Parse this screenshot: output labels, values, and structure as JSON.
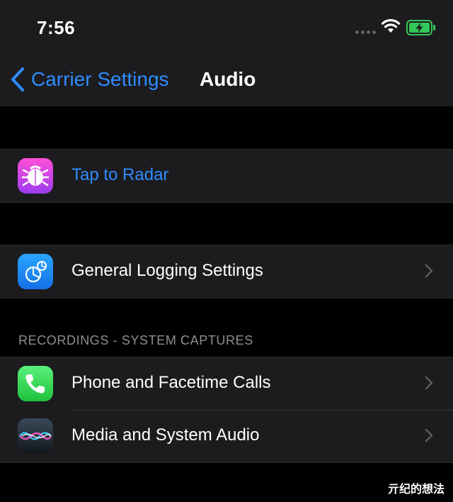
{
  "status_bar": {
    "time": "7:56"
  },
  "nav": {
    "back_label": "Carrier Settings",
    "title": "Audio"
  },
  "groups": {
    "radar": {
      "label": "Tap to Radar",
      "icon": "bug-icon"
    },
    "logging": {
      "label": "General Logging Settings",
      "icon": "logging-settings-icon"
    }
  },
  "recordings": {
    "header": "RECORDINGS - SYSTEM CAPTURES",
    "items": [
      {
        "label": "Phone and Facetime Calls",
        "icon": "phone-icon"
      },
      {
        "label": "Media and System Audio",
        "icon": "siri-waveform-icon"
      }
    ]
  },
  "watermark": "亓纪的想法",
  "colors": {
    "background": "#000000",
    "group_background": "#1c1c1e",
    "accent_blue": "#2f8cff",
    "secondary_text": "#8e8e93",
    "battery_green": "#34c759"
  }
}
